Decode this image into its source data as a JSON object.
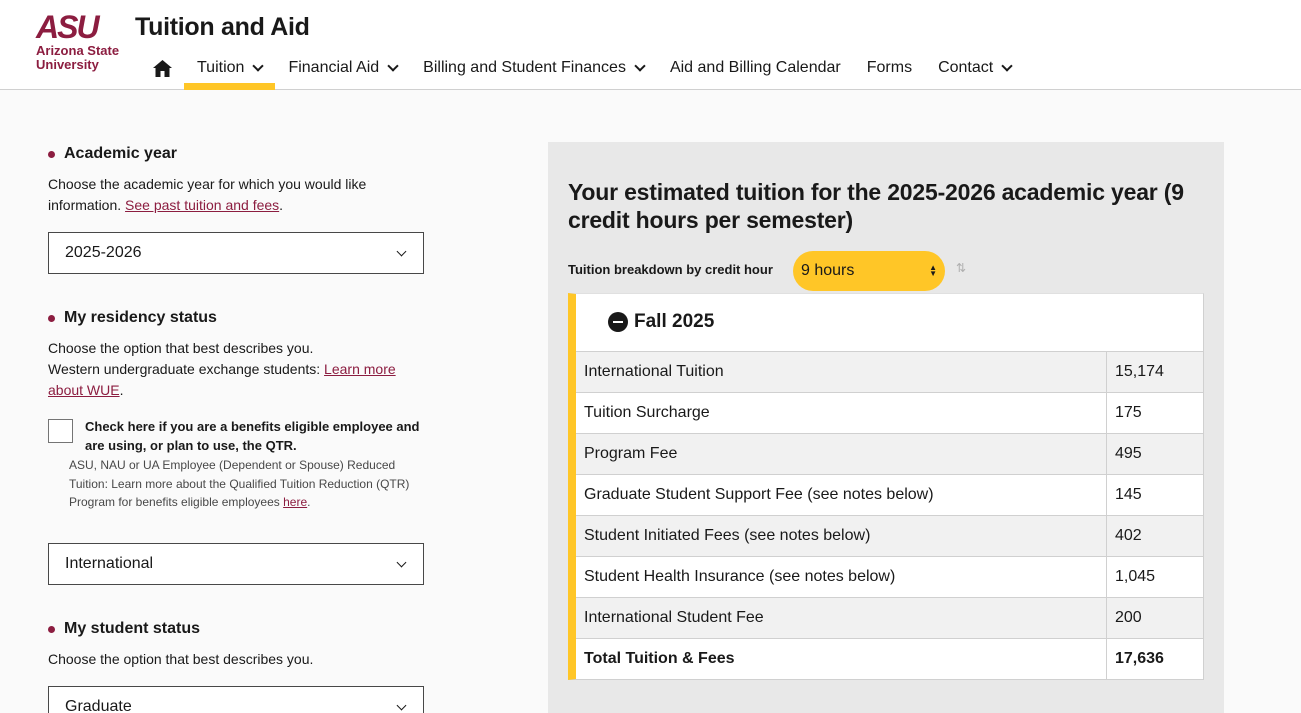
{
  "header": {
    "logo_mark": "ASU",
    "logo_name_line1": "Arizona State",
    "logo_name_line2": "University",
    "site_title": "Tuition and Aid",
    "nav": [
      {
        "label": "Tuition",
        "has_menu": true,
        "active": true
      },
      {
        "label": "Financial Aid",
        "has_menu": true
      },
      {
        "label": "Billing and Student Finances",
        "has_menu": true
      },
      {
        "label": "Aid and Billing Calendar",
        "has_menu": false
      },
      {
        "label": "Forms",
        "has_menu": false
      },
      {
        "label": "Contact",
        "has_menu": true
      }
    ]
  },
  "form": {
    "academic_year": {
      "label": "Academic year",
      "help_text": "Choose the academic year for which you would like information. ",
      "help_link": "See past tuition and fees",
      "help_suffix": ".",
      "selected": "2025-2026"
    },
    "residency": {
      "label": "My residency status",
      "help_line1": "Choose the option that best describes you.",
      "help_line2": "Western undergraduate exchange students: ",
      "help_link": "Learn more about WUE",
      "help_suffix": ".",
      "checkbox_label": "Check here if you are a benefits eligible employee and are using, or plan to use, the QTR.",
      "checkbox_note": "ASU, NAU or UA Employee (Dependent or Spouse) Reduced Tuition: Learn more about the Qualified Tuition Reduction (QTR) Program for benefits eligible employees ",
      "checkbox_note_link": "here",
      "checkbox_note_suffix": ".",
      "selected": "International"
    },
    "student_status": {
      "label": "My student status",
      "help_text": "Choose the option that best describes you.",
      "selected": "Graduate"
    }
  },
  "panel": {
    "title": "Your estimated tuition for the 2025-2026 academic year (9 credit hours per semester)",
    "breakdown_label": "Tuition breakdown by credit hour",
    "hours_selected": "9 hours",
    "semester": "Fall 2025",
    "rows": [
      {
        "label": "International Tuition",
        "value": "15,174"
      },
      {
        "label": "Tuition Surcharge",
        "value": "175"
      },
      {
        "label": "Program Fee",
        "value": "495"
      },
      {
        "label": "Graduate Student Support Fee (see notes below)",
        "value": "145"
      },
      {
        "label": "Student Initiated Fees (see notes below)",
        "value": "402"
      },
      {
        "label": "Student Health Insurance (see notes below)",
        "value": "1,045"
      },
      {
        "label": "International Student Fee",
        "value": "200"
      }
    ],
    "total": {
      "label": "Total Tuition & Fees",
      "value": "17,636"
    }
  },
  "colors": {
    "maroon": "#8c1d40",
    "gold": "#ffc627"
  },
  "icons": [
    "home-icon",
    "chevron-down-icon",
    "minus-circle-icon",
    "info-icon"
  ]
}
